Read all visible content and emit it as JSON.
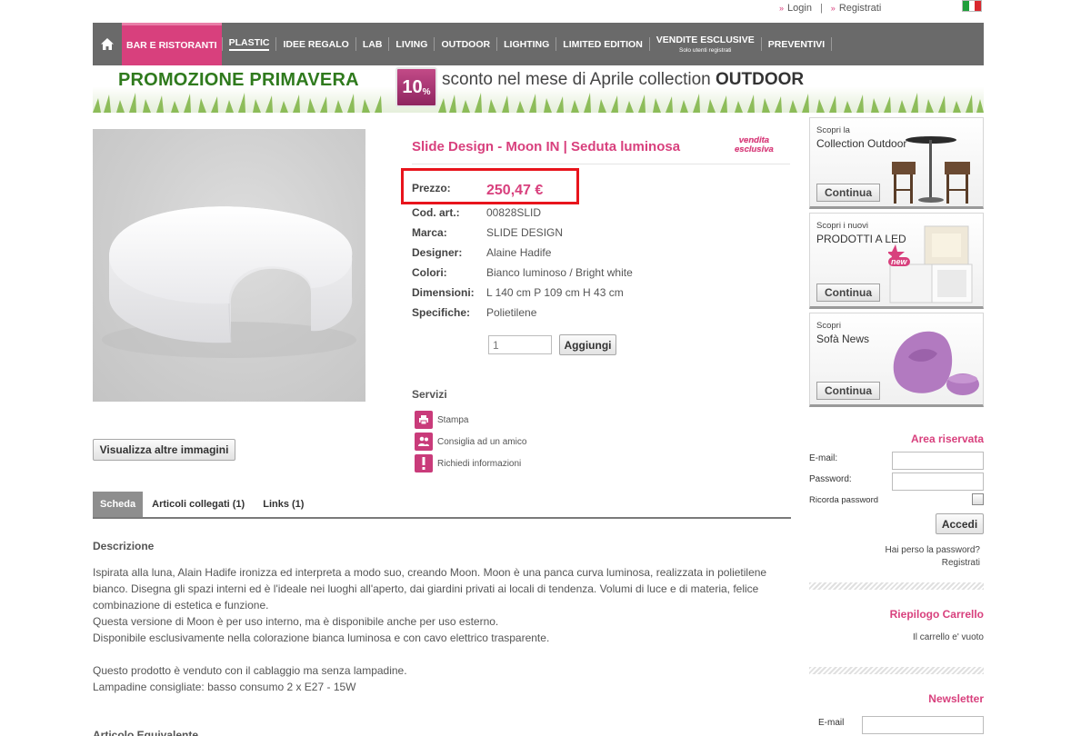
{
  "header": {
    "login_label": "Login",
    "separator": "|",
    "register_label": "Registrati",
    "flag_colors": [
      "#1f9e3a",
      "#ffffff",
      "#d8272e"
    ]
  },
  "nav": {
    "home_icon": "home-icon",
    "items": [
      {
        "label": "BAR E RISTORANTI",
        "active": true
      },
      {
        "label": "PLASTIC"
      },
      {
        "label": "IDEE REGALO"
      },
      {
        "label": "LAB"
      },
      {
        "label": "LIVING"
      },
      {
        "label": "OUTDOOR"
      },
      {
        "label": "LIGHTING"
      },
      {
        "label": "LIMITED EDITION"
      },
      {
        "label": "VENDITE ESCLUSIVE",
        "sub": "Solo utenti registrati"
      },
      {
        "label": "PREVENTIVI"
      }
    ]
  },
  "promo": {
    "title": "PROMOZIONE PRIMAVERA",
    "discount": "10",
    "percent": "%",
    "text": "sconto nel mese di Aprile collection",
    "text_bold": "OUTDOOR"
  },
  "product": {
    "title": "Slide Design - Moon IN | Seduta luminosa",
    "badge_line1": "vendita",
    "badge_line2": "esclusiva",
    "rows": [
      {
        "label": "Prezzo:",
        "value": "250,47 €"
      },
      {
        "label": "Cod. art.:",
        "value": "00828SLID"
      },
      {
        "label": "Marca:",
        "value": "SLIDE DESIGN"
      },
      {
        "label": "Designer:",
        "value": "Alaine Hadife"
      },
      {
        "label": "Colori:",
        "value": "Bianco luminoso / Bright white"
      },
      {
        "label": "Dimensioni:",
        "value": "L 140 cm P 109 cm H 43 cm"
      },
      {
        "label": "Specifiche:",
        "value": "Polietilene"
      }
    ],
    "qty_value": "1",
    "add_label": "Aggiungi",
    "more_images_label": "Visualizza altre immagini"
  },
  "services": {
    "title": "Servizi",
    "items": [
      {
        "label": "Stampa",
        "icon": "printer-icon"
      },
      {
        "label": "Consiglia ad un amico",
        "icon": "users-icon"
      },
      {
        "label": "Richiedi informazioni",
        "icon": "exclamation-icon"
      }
    ]
  },
  "tabs": [
    {
      "label": "Scheda",
      "active": true
    },
    {
      "label": "Articoli collegati (1)"
    },
    {
      "label": "Links (1)"
    }
  ],
  "description": {
    "heading": "Descrizione",
    "para1": "Ispirata alla luna, Alain Hadife ironizza ed interpreta a modo suo, creando Moon. Moon è una panca curva luminosa, realizzata in polietilene bianco. Disegna gli spazi interni ed è l'ideale nei luoghi all'aperto, dai giardini privati ai locali di tendenza. Volumi di luce e di materia, felice combinazione di estetica e funzione.\nQuesta versione di Moon è per uso interno, ma è disponibile anche per uso esterno.\nDisponibile esclusivamente nella colorazione bianca luminosa e con cavo elettrico trasparente.",
    "para2": "Questo prodotto è venduto con il cablaggio ma senza lampadine.\nLampadine consigliate: basso consumo 2 x E27 - 15W",
    "next_heading": "Articolo Equivalente"
  },
  "sidebar": {
    "promos": [
      {
        "line1": "Scopri la",
        "line2": "Collection Outdoor",
        "button": "Continua"
      },
      {
        "line1": "Scopri i nuovi",
        "line2": "PRODOTTI A LED",
        "button": "Continua",
        "badge": "new"
      },
      {
        "line1": "Scopri",
        "line2": "Sofà News",
        "button": "Continua"
      }
    ],
    "login": {
      "title": "Area riservata",
      "email_label": "E-mail:",
      "password_label": "Password:",
      "remember_label": "Ricorda password",
      "submit_label": "Accedi",
      "forgot_label": "Hai perso la password?",
      "register_label": "Registrati"
    },
    "cart": {
      "title": "Riepilogo Carrello",
      "empty_text": "Il carrello e' vuoto"
    },
    "newsletter": {
      "title": "Newsletter",
      "email_label": "E-mail"
    }
  },
  "colors": {
    "accent": "#d8407d",
    "nav_bg": "#6a6a6a",
    "promo_green": "#2f7a1d",
    "highlight": "#e8141c"
  }
}
